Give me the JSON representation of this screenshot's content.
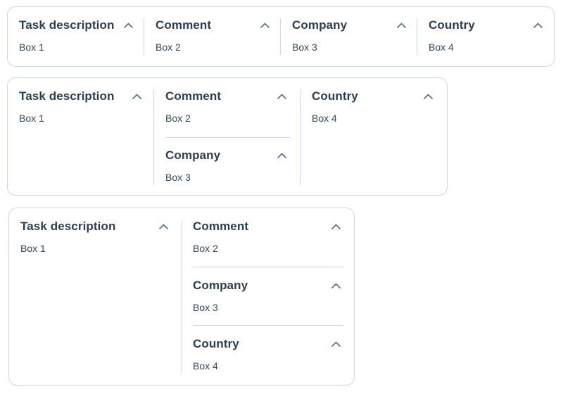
{
  "cards": [
    {
      "sections": [
        {
          "title": "Task description",
          "body": "Box 1",
          "icon": "chevron-up-icon"
        },
        {
          "title": "Comment",
          "body": "Box 2",
          "icon": "chevron-up-icon"
        },
        {
          "title": "Company",
          "body": "Box 3",
          "icon": "chevron-up-icon"
        },
        {
          "title": "Country",
          "body": "Box 4",
          "icon": "chevron-up-icon"
        }
      ]
    },
    {
      "sections": [
        {
          "title": "Task description",
          "body": "Box 1",
          "icon": "chevron-up-icon"
        },
        {
          "title": "Comment",
          "body": "Box 2",
          "icon": "chevron-up-icon"
        },
        {
          "title": "Company",
          "body": "Box 3",
          "icon": "chevron-up-icon"
        },
        {
          "title": "Country",
          "body": "Box 4",
          "icon": "chevron-up-icon"
        }
      ]
    },
    {
      "sections": [
        {
          "title": "Task description",
          "body": "Box 1",
          "icon": "chevron-up-icon"
        },
        {
          "title": "Comment",
          "body": "Box 2",
          "icon": "chevron-up-icon"
        },
        {
          "title": "Company",
          "body": "Box 3",
          "icon": "chevron-up-icon"
        },
        {
          "title": "Country",
          "body": "Box 4",
          "icon": "chevron-up-icon"
        }
      ]
    }
  ],
  "colors": {
    "border": "#cbd6e2",
    "title_text": "#2d3e50",
    "body_text": "#33475b",
    "chevron": "#516f90"
  }
}
